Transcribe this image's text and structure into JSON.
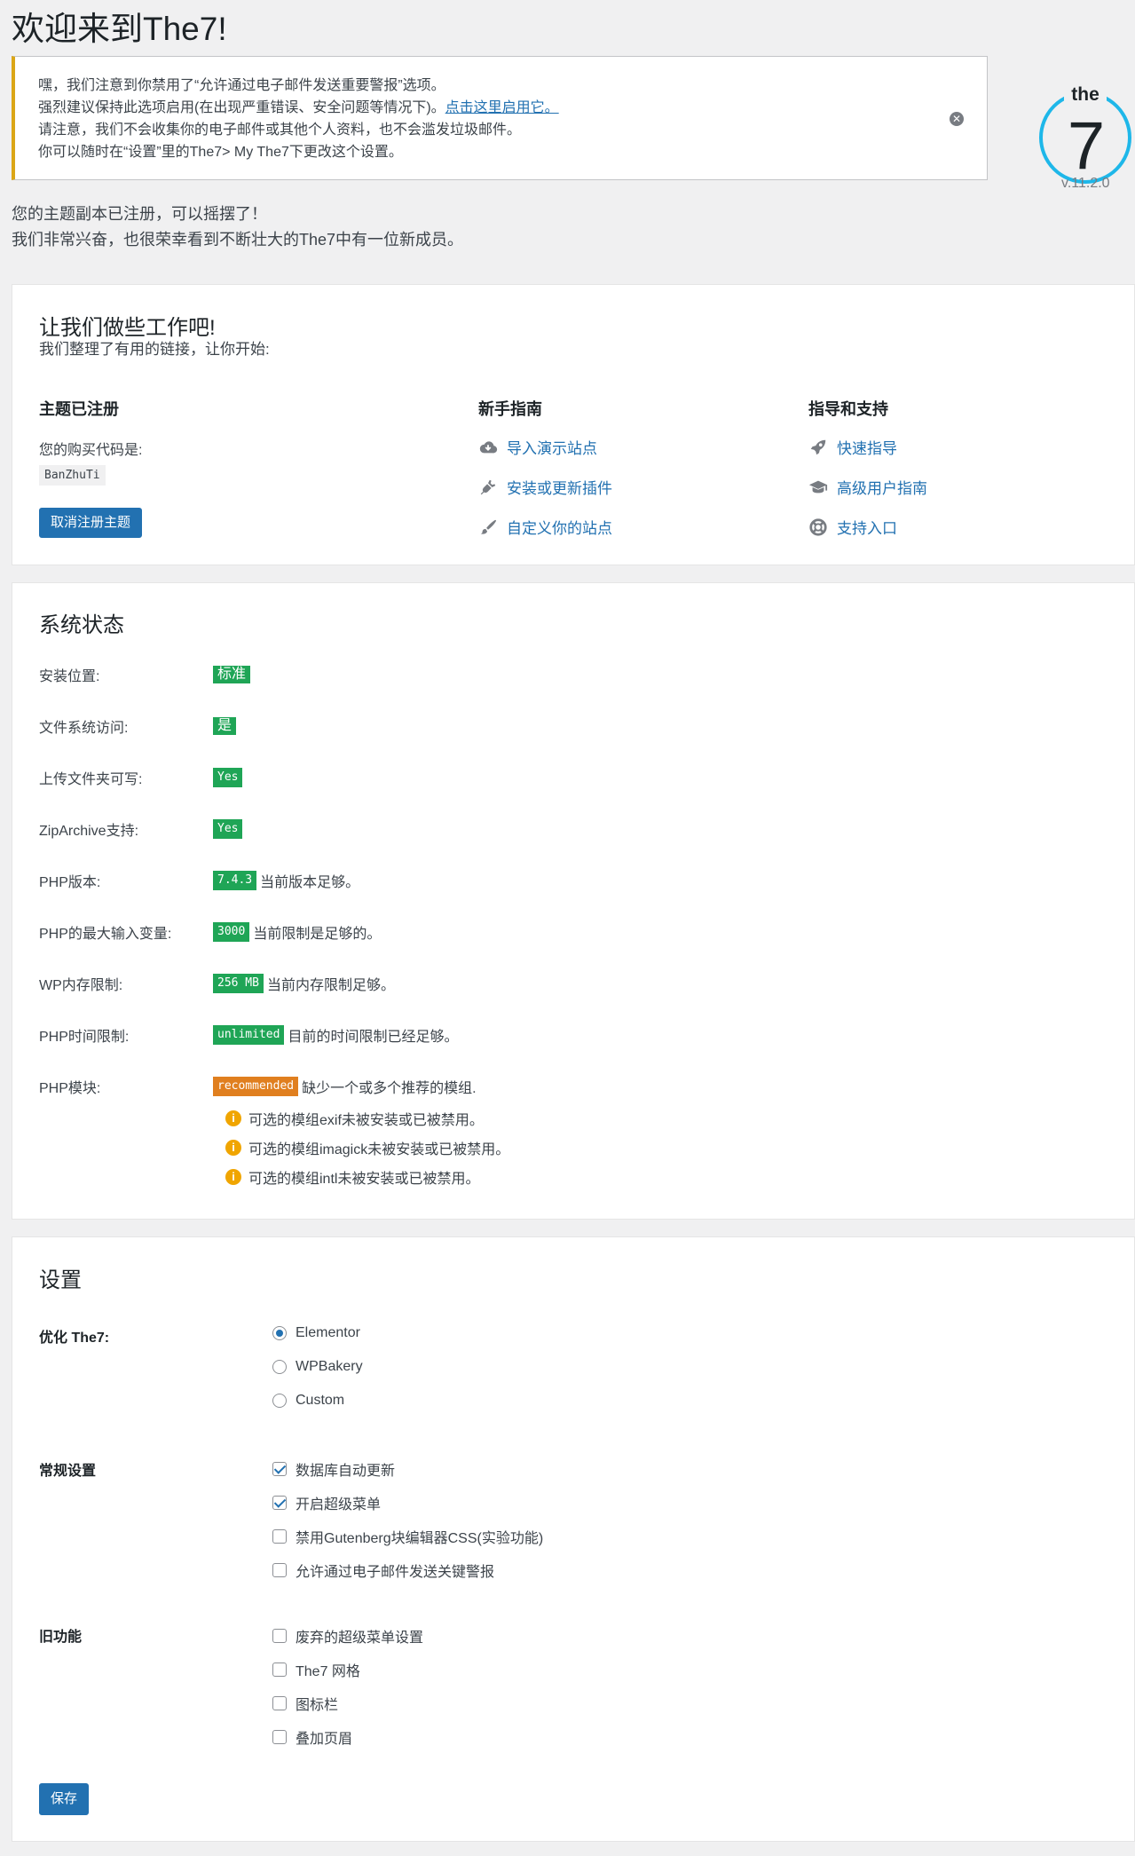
{
  "page": {
    "title": "欢迎来到The7!"
  },
  "notice": {
    "line1": "嘿，我们注意到你禁用了“允许通过电子邮件发送重要警报”选项。",
    "line2_text": "强烈建议保持此选项启用(在出现严重错误、安全问题等情况下)。",
    "line2_link": "点击这里启用它。",
    "line3": "请注意，我们不会收集你的电子邮件或其他个人资料，也不会滥发垃圾邮件。",
    "line4": "你可以随时在“设置”里的The7> My The7下更改这个设置。",
    "dismiss_icon": "close-circle-icon"
  },
  "logo": {
    "text": "the",
    "number": "7",
    "color": "#1eb7e9"
  },
  "version": "v.11.2.0",
  "intro": {
    "line1": "您的主题副本已注册，可以摇摆了！",
    "line2": "我们非常兴奋，也很荣幸看到不断壮大的The7中有一位新成员。"
  },
  "getting_started": {
    "title": "让我们做些工作吧!",
    "subtitle": "我们整理了有用的链接，让你开始:",
    "registered": {
      "title": "主题已注册",
      "code_label": "您的购买代码是:",
      "code": "BanZhuTi",
      "deregister_button": "取消注册主题"
    },
    "guide": {
      "title": "新手指南",
      "links": [
        {
          "icon": "cloud-download-icon",
          "label": "导入演示站点"
        },
        {
          "icon": "plugin-icon",
          "label": "安装或更新插件"
        },
        {
          "icon": "paintbrush-icon",
          "label": "自定义你的站点"
        }
      ]
    },
    "support": {
      "title": "指导和支持",
      "links": [
        {
          "icon": "rocket-icon",
          "label": "快速指导"
        },
        {
          "icon": "graduation-cap-icon",
          "label": "高级用户指南"
        },
        {
          "icon": "lifebuoy-icon",
          "label": "支持入口"
        }
      ]
    }
  },
  "system_status": {
    "title": "系统状态",
    "rows": [
      {
        "label": "安装位置:",
        "badge": "标准",
        "note": ""
      },
      {
        "label": "文件系统访问:",
        "badge": "是",
        "note": ""
      },
      {
        "label": "上传文件夹可写:",
        "badge": "Yes",
        "note": ""
      },
      {
        "label": "ZipArchive支持:",
        "badge": "Yes",
        "note": ""
      },
      {
        "label": "PHP版本:",
        "badge": "7.4.3",
        "note": "当前版本足够。"
      },
      {
        "label": "PHP的最大输入变量:",
        "badge": "3000",
        "note": "当前限制是足够的。"
      },
      {
        "label": "WP内存限制:",
        "badge": "256 MB",
        "note": "当前内存限制足够。"
      },
      {
        "label": "PHP时间限制:",
        "badge": "unlimited",
        "note": "目前的时间限制已经足够。"
      },
      {
        "label": "PHP模块:",
        "badge": "recommended",
        "note": "缺少一个或多个推荐的模组."
      }
    ],
    "warnings": [
      "可选的模组exif未被安装或已被禁用。",
      "可选的模组imagick未被安装或已被禁用。",
      "可选的模组intl未被安装或已被禁用。"
    ],
    "colors": {
      "ok": "#1fa556",
      "warn": "#e07f1f",
      "info": "#f0a500"
    }
  },
  "settings": {
    "title": "设置",
    "optimize": {
      "label": "优化 The7:",
      "options": [
        "Elementor",
        "WPBakery",
        "Custom"
      ],
      "selected": "Elementor"
    },
    "general": {
      "label": "常规设置",
      "options": [
        {
          "label": "数据库自动更新",
          "checked": true
        },
        {
          "label": "开启超级菜单",
          "checked": true
        },
        {
          "label": "禁用Gutenberg块编辑器CSS(实验功能)",
          "checked": false
        },
        {
          "label": "允许通过电子邮件发送关键警报",
          "checked": false
        }
      ]
    },
    "legacy": {
      "label": "旧功能",
      "options": [
        {
          "label": "废弃的超级菜单设置",
          "checked": false
        },
        {
          "label": "The7 网格",
          "checked": false
        },
        {
          "label": "图标栏",
          "checked": false
        },
        {
          "label": "叠加页眉",
          "checked": false
        }
      ]
    },
    "save_button": "保存"
  }
}
